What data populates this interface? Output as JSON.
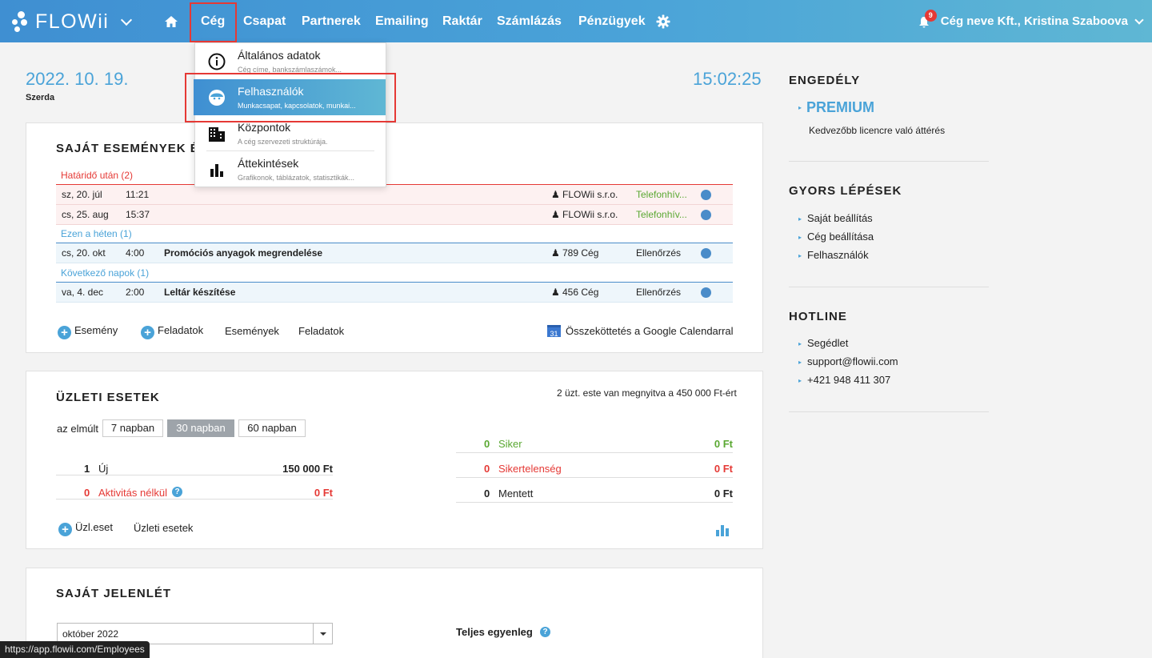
{
  "brand": {
    "name": "FLOWii"
  },
  "nav": {
    "items": [
      {
        "label": "Cég"
      },
      {
        "label": "Csapat"
      },
      {
        "label": "Partnerek"
      },
      {
        "label": "Emailing"
      },
      {
        "label": "Raktár"
      },
      {
        "label": "Számlázás"
      },
      {
        "label": "Pénzügyek"
      }
    ],
    "icons": [
      "home-icon",
      "gear-icon",
      "bell-icon"
    ],
    "notifications": "9",
    "user": "Cég neve Kft., Kristina Szaboova"
  },
  "dropdown": {
    "items": [
      {
        "title": "Általános adatok",
        "subtitle": "Cég címe, bankszámlaszámok...",
        "icon": "info-icon"
      },
      {
        "title": "Felhasználók",
        "subtitle": "Munkacsapat, kapcsolatok, munkai...",
        "icon": "user-face-icon"
      },
      {
        "title": "Központok",
        "subtitle": "A cég szervezeti struktúrája.",
        "icon": "building-icon"
      },
      {
        "title": "Áttekintések",
        "subtitle": "Grafikonok, táblázatok, statisztikák...",
        "icon": "bar-chart-icon"
      }
    ]
  },
  "header": {
    "date": "2022. 10. 19.",
    "weekday": "Szerda",
    "time": "15:02:25"
  },
  "events": {
    "title": "SAJÁT ESEMÉNYEK É",
    "sections": [
      {
        "label": "Határidő után (2)",
        "color": "#e53935"
      },
      {
        "label": "Ezen a héten (1)",
        "color": "#4aa3d8"
      },
      {
        "label": "Következő napok (1)",
        "color": "#4aa3d8"
      }
    ],
    "rows": [
      {
        "date": "sz, 20. júl",
        "time": "11:21",
        "title": "",
        "company": "FLOWii s.r.o.",
        "type": "Telefonhív..."
      },
      {
        "date": "cs, 25. aug",
        "time": "15:37",
        "title": "",
        "company": "FLOWii s.r.o.",
        "type": "Telefonhív..."
      },
      {
        "date": "cs, 20. okt",
        "time": "4:00",
        "title": "Promóciós anyagok megrendelése",
        "company": "789 Cég",
        "type": "Ellenőrzés"
      },
      {
        "date": "va, 4. dec",
        "time": "2:00",
        "title": "Leltár készítése",
        "company": "456 Cég",
        "type": "Ellenőrzés"
      }
    ],
    "actions": {
      "event": "Esemény",
      "task": "Feladatok",
      "events": "Események",
      "tasks": "Feladatok",
      "google": "Összeköttetés a Google Calendarral",
      "google_icon": "31"
    }
  },
  "deals": {
    "title": "ÜZLETI ESETEK",
    "summary": "2 üzt. este van megnyitva a 450 000 Ft-ért",
    "period_label": "az elmúlt",
    "periods": [
      "7 napban",
      "30 napban",
      "60 napban"
    ],
    "selected_period": "30 napban",
    "left": [
      {
        "count": "1",
        "label": "Új",
        "amount": "150 000 Ft"
      },
      {
        "count": "0",
        "label": "Aktivitás nélkül",
        "amount": "0 Ft"
      }
    ],
    "right": [
      {
        "count": "0",
        "label": "Siker",
        "amount": "0 Ft"
      },
      {
        "count": "0",
        "label": "Sikertelenség",
        "amount": "0 Ft"
      },
      {
        "count": "0",
        "label": "Mentett",
        "amount": "0 Ft"
      }
    ],
    "actions": {
      "new": "Üzl.eset",
      "list": "Üzleti esetek"
    }
  },
  "attendance": {
    "title": "SAJÁT JELENLÉT",
    "month": "október 2022",
    "balance_label": "Teljes egyenleg"
  },
  "sidebar": {
    "license": {
      "heading": "ENGEDÉLY",
      "plan": "PREMIUM",
      "note": "Kedvezőbb licencre való áttérés"
    },
    "quick": {
      "heading": "GYORS LÉPÉSEK",
      "links": [
        "Saját beállítás",
        "Cég beállítása",
        "Felhasználók"
      ]
    },
    "hotline": {
      "heading": "HOTLINE",
      "links": [
        "Segédlet",
        "support@flowii.com",
        "+421 948 411 307"
      ]
    }
  },
  "status_url": "https://app.flowii.com/Employees",
  "colors": {
    "accent": "#4aa3d8",
    "red": "#e53935",
    "green": "#5aa832",
    "highlight": "#e53935"
  }
}
